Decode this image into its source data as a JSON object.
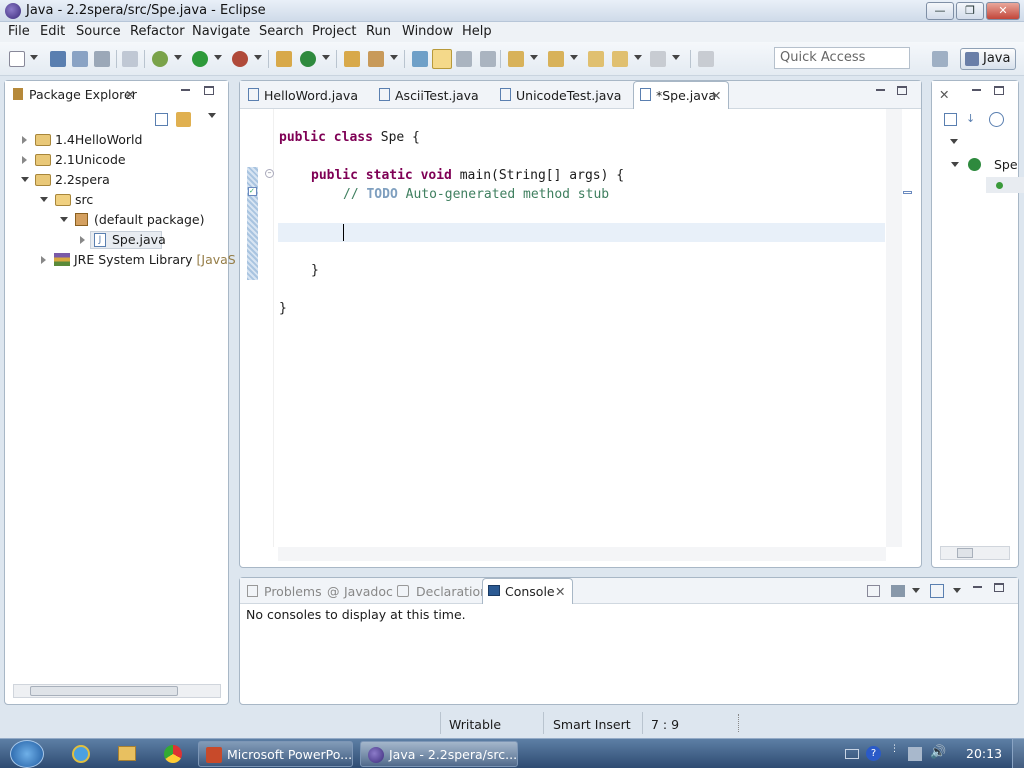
{
  "window": {
    "title": "Java - 2.2spera/src/Spe.java - Eclipse",
    "min": "—",
    "max": "❐",
    "close": "✕"
  },
  "menu": [
    "File",
    "Edit",
    "Source",
    "Refactor",
    "Navigate",
    "Search",
    "Project",
    "Run",
    "Window",
    "Help"
  ],
  "toolbar": {
    "quick_access_placeholder": "Quick Access",
    "perspective": "Java"
  },
  "package_explorer": {
    "title": "Package Explorer",
    "items": [
      {
        "label": "1.4HelloWorld"
      },
      {
        "label": "2.1Unicode"
      },
      {
        "label": "2.2spera"
      },
      {
        "label": "src"
      },
      {
        "label": "(default package)"
      },
      {
        "label": "Spe.java"
      },
      {
        "label": "JRE System Library",
        "decoration": "[JavaS"
      }
    ]
  },
  "editor": {
    "tabs": [
      "HelloWord.java",
      "AsciiTest.java",
      "UnicodeTest.java",
      "*Spe.java"
    ],
    "code": {
      "l1_kw": "public class",
      "l1_rest": " Spe {",
      "l2_kw": "public static void",
      "l2_rest": " main(String[] args) {",
      "l3_slashes": "// ",
      "l3_todo": "TODO",
      "l3_rest": " Auto-generated method stub",
      "l5": "}",
      "l6": "}"
    }
  },
  "outline": {
    "item": "Spe"
  },
  "bottom_panel": {
    "tabs": [
      "Problems",
      "Javadoc",
      "Declaration",
      "Console"
    ],
    "message": "No consoles to display at this time."
  },
  "status": {
    "writable": "Writable",
    "insert_mode": "Smart Insert",
    "position": "7 : 9"
  },
  "taskbar": {
    "tasks": [
      "Microsoft PowerPo...",
      "Java - 2.2spera/src..."
    ],
    "clock": "20:13"
  }
}
